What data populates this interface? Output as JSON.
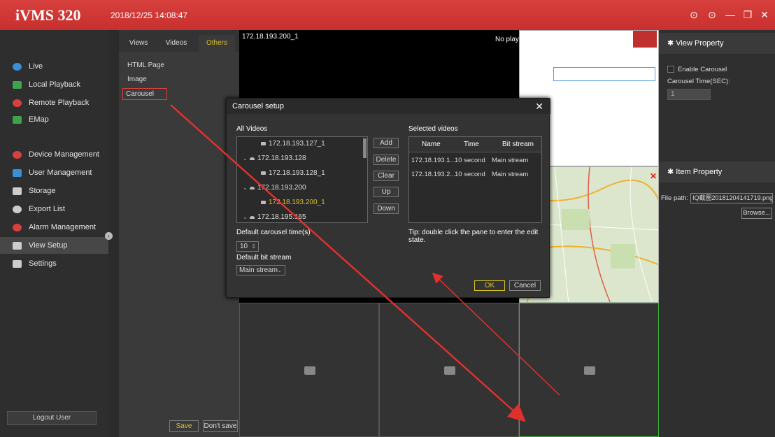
{
  "app": {
    "title": "iVMS 320",
    "datetime": "2018/12/25 14:08:47"
  },
  "window_buttons": [
    "help-icon",
    "info-icon",
    "minimize-icon",
    "restore-icon",
    "close-icon"
  ],
  "nav": {
    "items": [
      {
        "label": "Live",
        "icon": "live-icon",
        "color": "#3b8fd9"
      },
      {
        "label": "Local Playback",
        "icon": "local-playback-icon",
        "color": "#3fa34d"
      },
      {
        "label": "Remote Playback",
        "icon": "remote-playback-icon",
        "color": "#d9403d"
      },
      {
        "label": "EMap",
        "icon": "emap-icon",
        "color": "#3fa34d"
      },
      {
        "label": "Device Management",
        "icon": "device-management-icon",
        "color": "#d9403d"
      },
      {
        "label": "User Management",
        "icon": "user-management-icon",
        "color": "#3b8fd9"
      },
      {
        "label": "Storage",
        "icon": "storage-icon",
        "color": "#cccccc"
      },
      {
        "label": "Export List",
        "icon": "export-list-icon",
        "color": "#cccccc"
      },
      {
        "label": "Alarm Management",
        "icon": "alarm-management-icon",
        "color": "#d9403d"
      },
      {
        "label": "View Setup",
        "icon": "view-setup-icon",
        "color": "#cccccc"
      },
      {
        "label": "Settings",
        "icon": "settings-icon",
        "color": "#cccccc"
      }
    ],
    "active": "View Setup",
    "logout_label": "Logout User"
  },
  "resource_panel": {
    "tabs": [
      "Views",
      "Videos",
      "Others"
    ],
    "active_tab": "Others",
    "items": [
      "HTML Page",
      "Image",
      "Carousel"
    ],
    "selected_item": "Carousel",
    "save_label": "Save",
    "dont_save_label": "Don't save"
  },
  "grid": {
    "pane1_title": "172.18.193.200_1",
    "pane1_status": "No play"
  },
  "right_panel": {
    "view_property_title": "View Property",
    "enable_carousel_label": "Enable Carousel",
    "carousel_time_label": "Carousel Time(SEC):",
    "carousel_time_value": "1",
    "item_property_title": "Item Property",
    "file_path_label": "File path:",
    "file_path_value": "IQ截图20181204141719.png",
    "browse_label": "Browse..."
  },
  "dialog": {
    "title": "Carousel setup",
    "all_videos_label": "All Videos",
    "tree": [
      {
        "label": "172.18.193.127_1",
        "type": "camera",
        "level": 2
      },
      {
        "label": "172.18.193.128",
        "type": "device",
        "level": 1
      },
      {
        "label": "172.18.193.128_1",
        "type": "camera",
        "level": 2
      },
      {
        "label": "172.18.193.200",
        "type": "device",
        "level": 1
      },
      {
        "label": "172.18.193.200_1",
        "type": "camera",
        "level": 2,
        "selected": true
      },
      {
        "label": "172.18.195.165",
        "type": "device",
        "level": 1
      }
    ],
    "buttons": {
      "add": "Add",
      "delete": "Delete",
      "clear": "Clear",
      "up": "Up",
      "down": "Down"
    },
    "selected_videos_label": "Selected videos",
    "columns": [
      "Name",
      "Time",
      "Bit stream"
    ],
    "rows": [
      {
        "name": "172.18.193.1...",
        "time": "10 second",
        "stream": "Main stream"
      },
      {
        "name": "172.18.193.2...",
        "time": "10 second",
        "stream": "Main stream"
      }
    ],
    "default_time_label": "Default carousel time(s)",
    "default_time_value": "10",
    "default_bitstream_label": "Default bit stream",
    "default_bitstream_value": "Main stream",
    "tip": "Tip: double click the pane to enter the edit state.",
    "ok_label": "OK",
    "cancel_label": "Cancel"
  }
}
